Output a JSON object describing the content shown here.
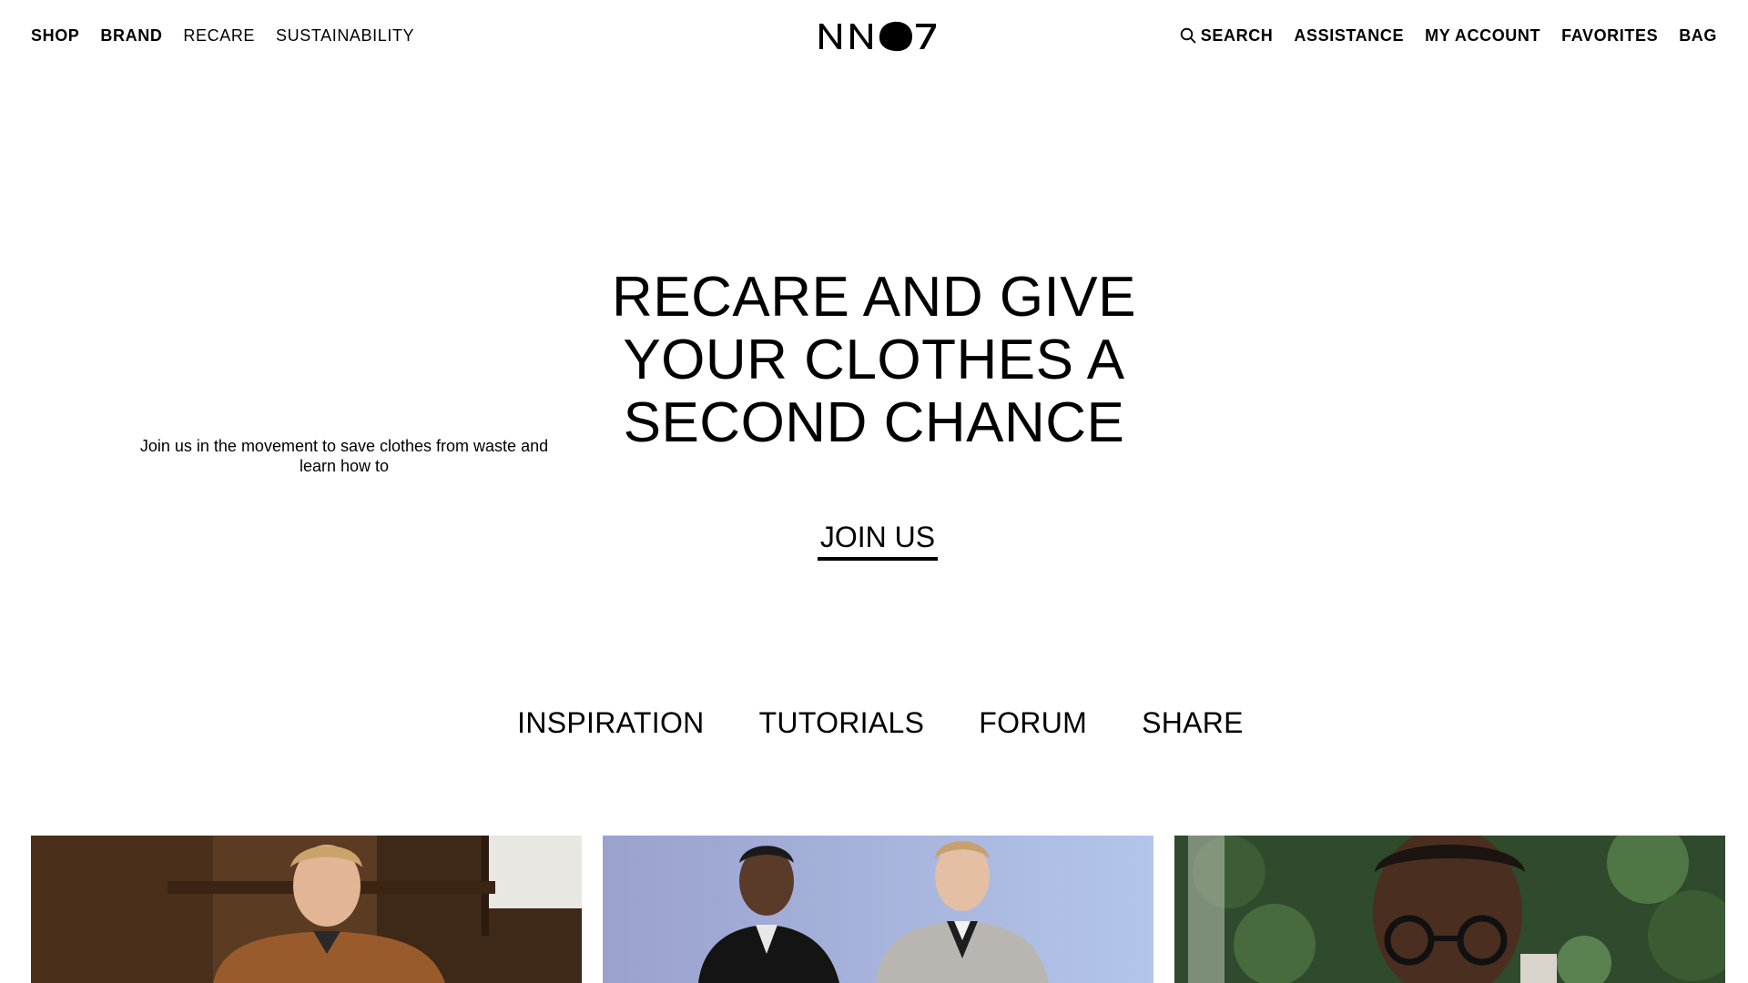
{
  "nav": {
    "left": [
      {
        "label": "SHOP",
        "bold": true
      },
      {
        "label": "BRAND",
        "bold": true
      },
      {
        "label": "RECARE",
        "bold": false
      },
      {
        "label": "SUSTAINABILITY",
        "bold": false
      }
    ],
    "right": {
      "search": "SEARCH",
      "assistance": "ASSISTANCE",
      "account": "MY ACCOUNT",
      "favorites": "FAVORITES",
      "bag": "BAG"
    },
    "logo_text": "NN07",
    "icons": {
      "search": "search-icon"
    }
  },
  "hero": {
    "title_lines": [
      "RECARE AND GIVE",
      "YOUR CLOTHES A",
      "SECOND CHANCE"
    ],
    "subtitle": "Join us in the movement to save clothes from waste and learn how to",
    "cta": "JOIN US"
  },
  "tabs": [
    "INSPIRATION",
    "TUTORIALS",
    "FORUM",
    "SHARE"
  ],
  "cards": [
    {
      "name": "card-inspiration-photo",
      "subject": "man in brown shirt in wooden interior"
    },
    {
      "name": "card-tutorials-photo",
      "subject": "two men in jackets against blue background"
    },
    {
      "name": "card-share-photo",
      "subject": "man with glasses in front of ivy"
    }
  ],
  "colors": {
    "text": "#000000",
    "background": "#ffffff",
    "card1_bg": "#5b3b22",
    "card2_bg": "#9fa9d4",
    "card3_bg": "#2f4a2c"
  }
}
